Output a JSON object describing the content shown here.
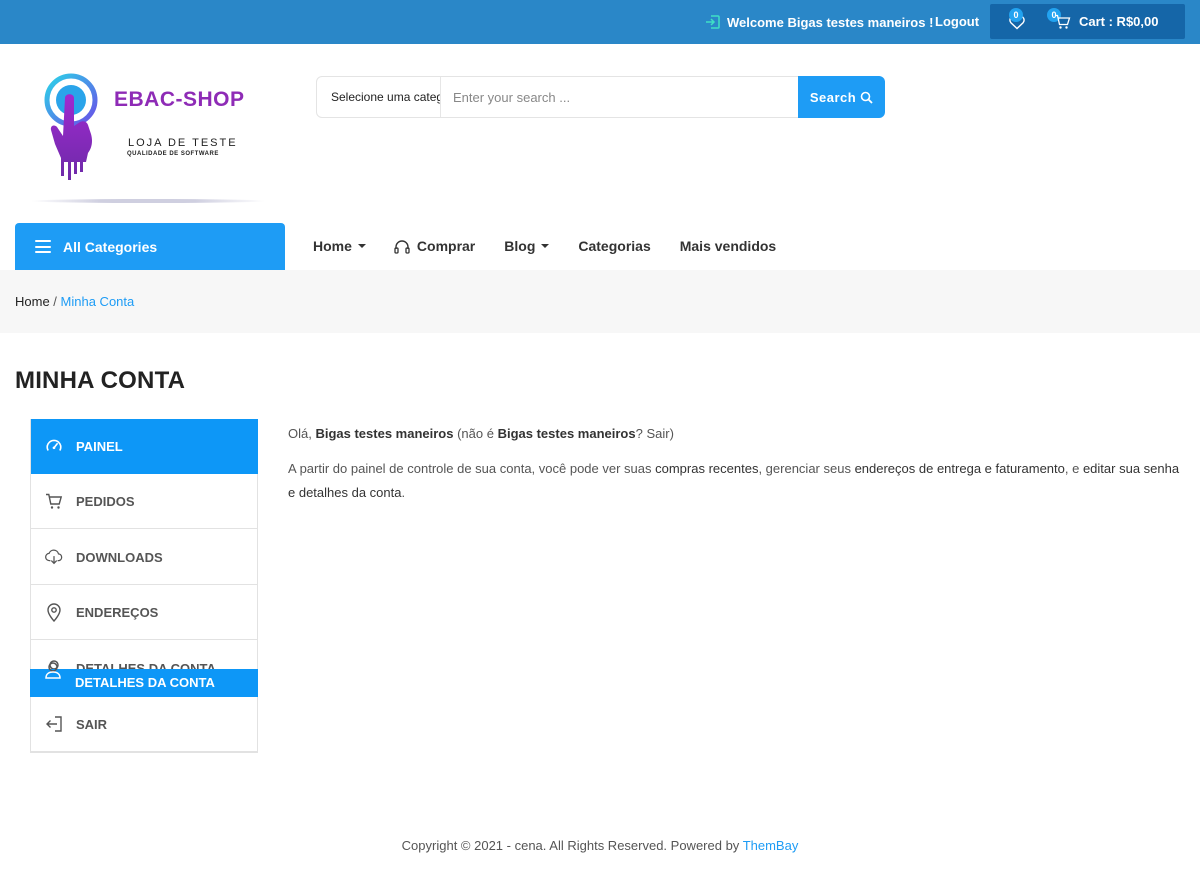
{
  "topbar": {
    "welcome": "Welcome Bigas testes maneiros !",
    "logout": "Logout",
    "wishlist_count": "0",
    "cart_count": "0",
    "cart_label": "Cart : R$0,00"
  },
  "logo": {
    "title": "EBAC-SHOP",
    "subtitle": "LOJA DE TESTE",
    "tagline": "QUALIDADE DE SOFTWARE"
  },
  "search": {
    "category": "Selecione uma categoria",
    "placeholder": "Enter your search ...",
    "button": "Search"
  },
  "nav": {
    "all_categories": "All Categories",
    "items": [
      {
        "label": "Home",
        "dropdown": true
      },
      {
        "label": "Comprar",
        "icon": "headphones-icon"
      },
      {
        "label": "Blog",
        "dropdown": true
      },
      {
        "label": "Categorias"
      },
      {
        "label": "Mais vendidos"
      }
    ]
  },
  "breadcrumb": {
    "home": "Home",
    "separator": " / ",
    "current": "Minha Conta"
  },
  "page_title": "MINHA CONTA",
  "account_nav": [
    {
      "label": "PAINEL",
      "icon": "dashboard-icon",
      "active": true
    },
    {
      "label": "PEDIDOS",
      "icon": "cart-icon"
    },
    {
      "label": "DOWNLOADS",
      "icon": "cloud-download-icon"
    },
    {
      "label": "ENDEREÇOS",
      "icon": "location-pin-icon"
    },
    {
      "label": "DETALHES DA CONTA",
      "icon": "user-icon"
    },
    {
      "label": "SAIR",
      "icon": "logout-icon"
    }
  ],
  "content": {
    "greeting_prefix": "Olá, ",
    "user": "Bigas testes maneiros",
    "greeting_mid": " (não é ",
    "user2": "Bigas testes maneiros",
    "greeting_q": "? ",
    "sair": "Sair",
    "greeting_end": ")",
    "p2_a": "A partir do painel de controle de sua conta, você pode ver suas ",
    "link_orders": "compras recentes",
    "p2_b": ", gerenciar seus ",
    "link_addresses": "endereços de entrega e faturamento",
    "p2_c": ", e ",
    "link_account": "editar sua senha e detalhes da conta",
    "p2_d": "."
  },
  "footer": {
    "text": "Copyright © 2021 - cena. All Rights Reserved. Powered by ",
    "brand": "ThemBay"
  },
  "colors": {
    "topbar": "#2a87c8",
    "accent": "#1e9cf5",
    "logo_purple": "#8e2bb6"
  }
}
